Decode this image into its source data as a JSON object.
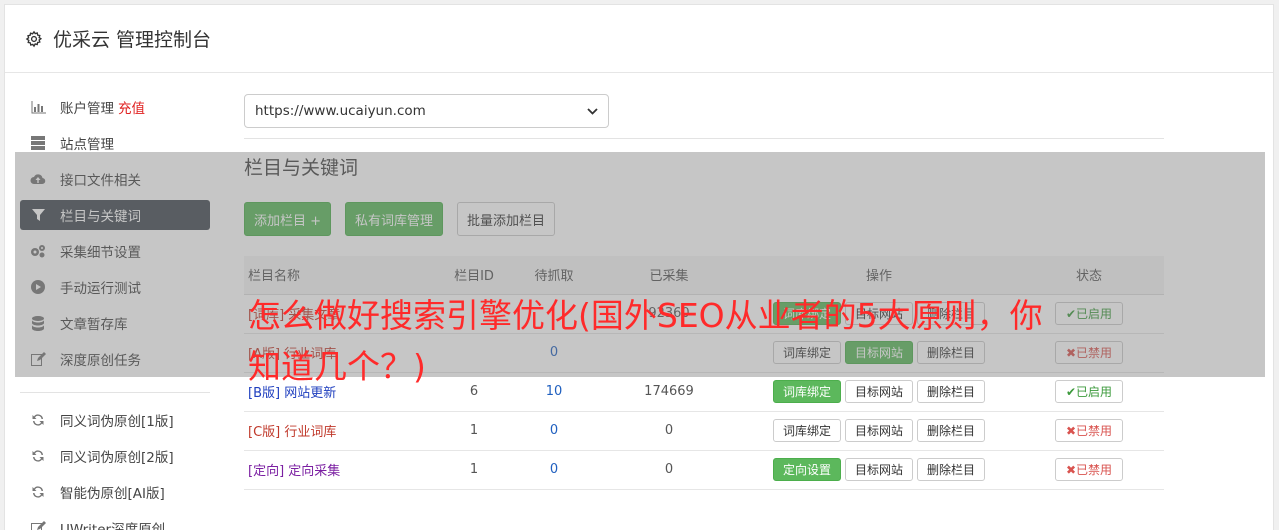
{
  "header": {
    "title": "优采云 管理控制台",
    "icon": "gear-icon"
  },
  "sidebar": {
    "items": [
      {
        "label": "账户管理",
        "extra": "充值",
        "icon": "bar-chart-icon"
      },
      {
        "label": "站点管理",
        "icon": "server-icon"
      },
      {
        "label": "接口文件相关",
        "icon": "cloud-upload-icon"
      },
      {
        "label": "栏目与关键词",
        "icon": "filter-icon",
        "active": true
      },
      {
        "label": "采集细节设置",
        "icon": "cogs-icon"
      },
      {
        "label": "手动运行测试",
        "icon": "play-icon"
      },
      {
        "label": "文章暂存库",
        "icon": "database-icon"
      },
      {
        "label": "深度原创任务",
        "icon": "edit-icon"
      }
    ],
    "items2": [
      {
        "label": "同义词伪原创[1版]",
        "icon": "refresh-icon"
      },
      {
        "label": "同义词伪原创[2版]",
        "icon": "refresh-icon"
      },
      {
        "label": "智能伪原创[AI版]",
        "icon": "refresh-icon"
      },
      {
        "label": "UWriter深度原创",
        "icon": "edit-icon"
      }
    ]
  },
  "main": {
    "site_select": "https://www.ucaiyun.com",
    "section_title": "栏目与关键词",
    "buttons": {
      "add": "添加栏目 +",
      "private": "私有词库管理",
      "batch": "批量添加栏目"
    },
    "table": {
      "headers": [
        "栏目名称",
        "栏目ID",
        "待抓取",
        "已采集",
        "操作",
        "状态"
      ],
      "rows": [
        {
          "tag": "[词库]",
          "name": "采集文章",
          "id": "",
          "pending": "",
          "collected": "92360",
          "op1": "词库绑定",
          "op2": "目标网站",
          "op3": "删除栏目",
          "status": "✔已启用"
        },
        {
          "tag": "[A版]",
          "name": "行业词库",
          "id": "",
          "pending": "0",
          "collected": "",
          "op1": "词库绑定",
          "op2": "目标网站",
          "op3": "删除栏目",
          "status": "✖已禁用"
        },
        {
          "tag": "[B版]",
          "name": "网站更新",
          "id": "6",
          "pending": "10",
          "collected": "174669",
          "op1": "词库绑定",
          "op2": "目标网站",
          "op3": "删除栏目",
          "status": "✔已启用"
        },
        {
          "tag": "[C版]",
          "name": "行业词库",
          "id": "1",
          "pending": "0",
          "collected": "0",
          "op1": "词库绑定",
          "op2": "目标网站",
          "op3": "删除栏目",
          "status": "✖已禁用"
        },
        {
          "tag": "[定向]",
          "name": "定向采集",
          "id": "1",
          "pending": "0",
          "collected": "0",
          "op1": "定向设置",
          "op2": "目标网站",
          "op3": "删除栏目",
          "status": "✖已禁用"
        }
      ]
    }
  },
  "overlay_headline": "怎么做好搜索引擎优化(国外SEO从业者的5大原则，你知道几个？)",
  "colors": {
    "green": "#5cb85c",
    "sidebar_active": "#444b53",
    "headline": "#ff2a2a"
  }
}
